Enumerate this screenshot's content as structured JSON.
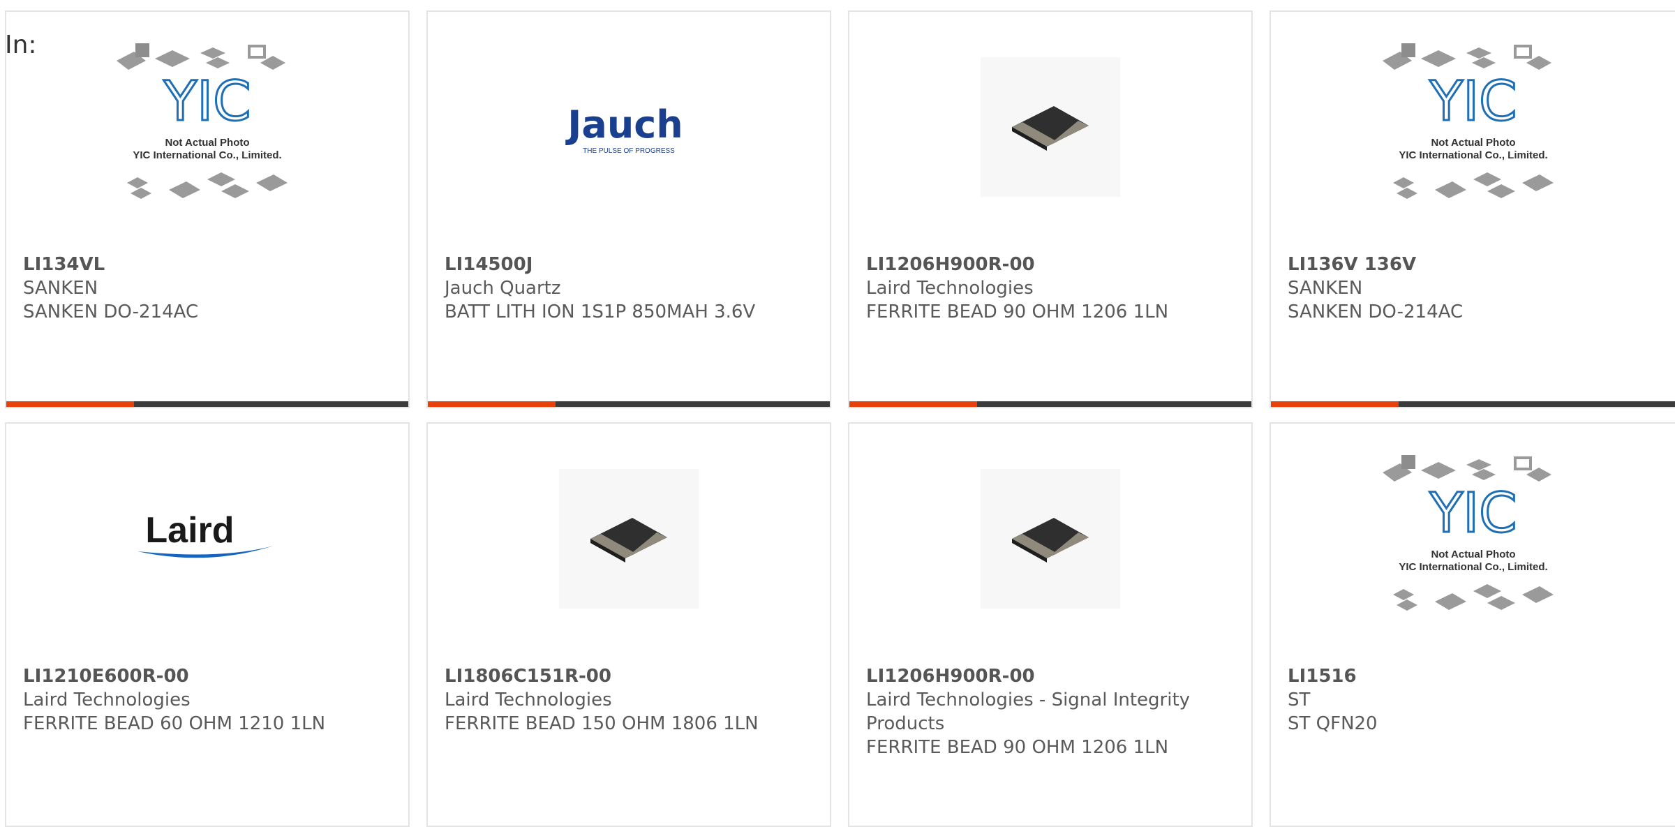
{
  "header": {
    "label": "In:"
  },
  "cards": [
    {
      "part": "LI134VL",
      "maker": "SANKEN",
      "desc": "SANKEN DO-214AC",
      "image": "yic-not-actual-photo",
      "yic_line1": "Not Actual Photo",
      "yic_line2": "YIC International Co., Limited."
    },
    {
      "part": "LI14500J",
      "maker": "Jauch Quartz",
      "desc": "BATT LITH ION 1S1P 850MAH 3.6V",
      "image": "jauch-logo",
      "logo_text": "Jauch",
      "logo_tagline": "THE PULSE OF PROGRESS"
    },
    {
      "part": "LI1206H900R-00",
      "maker": "Laird Technologies",
      "desc": "FERRITE BEAD 90 OHM 1206 1LN",
      "image": "ferrite-bead-photo"
    },
    {
      "part": "LI136V 136V",
      "maker": "SANKEN",
      "desc": "SANKEN DO-214AC",
      "image": "yic-not-actual-photo",
      "yic_line1": "Not Actual Photo",
      "yic_line2": "YIC International Co., Limited."
    },
    {
      "part": "LI1210E600R-00",
      "maker": "Laird Technologies",
      "desc": "FERRITE BEAD 60 OHM 1210 1LN",
      "image": "laird-logo",
      "logo_text": "Laird"
    },
    {
      "part": "LI1806C151R-00",
      "maker": "Laird Technologies",
      "desc": "FERRITE BEAD 150 OHM 1806 1LN",
      "image": "ferrite-bead-photo"
    },
    {
      "part": "LI1206H900R-00",
      "maker": "Laird Technologies - Signal Integrity Products",
      "desc": "FERRITE BEAD 90 OHM 1206 1LN",
      "image": "ferrite-bead-photo"
    },
    {
      "part": "LI1516",
      "maker": "ST",
      "desc": "ST QFN20",
      "image": "yic-not-actual-photo",
      "yic_line1": "Not Actual Photo",
      "yic_line2": "YIC International Co., Limited."
    }
  ],
  "colors": {
    "accent": "#e8420c",
    "bar": "#3c3c3c",
    "border": "#e4e4e4",
    "yic_blue": "#1f6fb5"
  }
}
